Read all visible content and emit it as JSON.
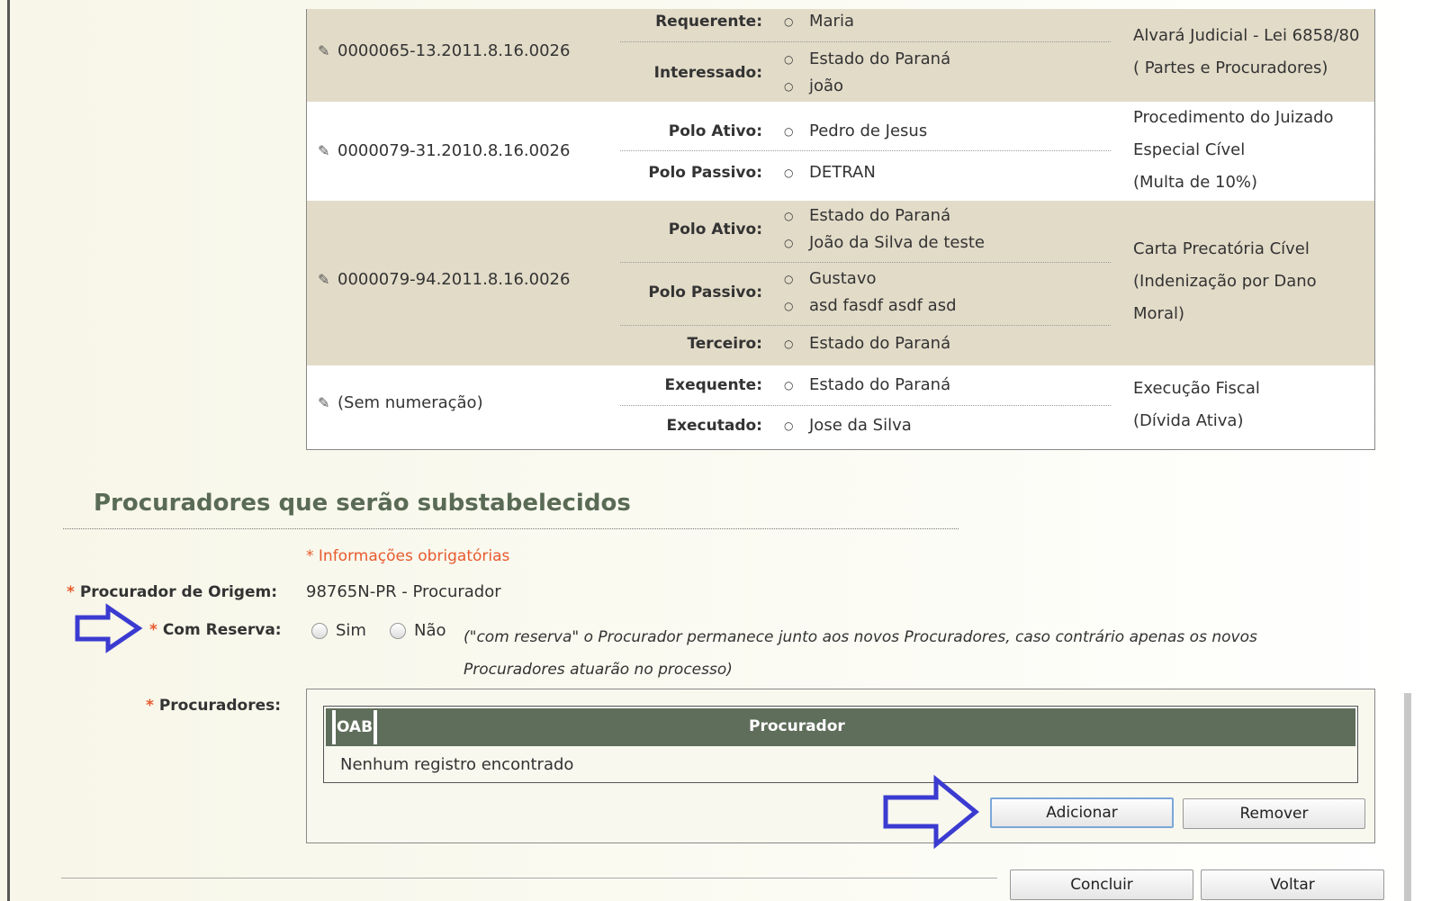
{
  "processes": [
    {
      "number": "0000065-13.2011.8.16.0026",
      "parties": [
        {
          "role": "Requerente:",
          "names": [
            "Maria"
          ]
        },
        {
          "role": "Interessado:",
          "names": [
            "Estado do Paraná",
            "joão"
          ]
        }
      ],
      "description": [
        "Alvará Judicial - Lei 6858/80",
        "( Partes e Procuradores)"
      ]
    },
    {
      "number": "0000079-31.2010.8.16.0026",
      "parties": [
        {
          "role": "Polo Ativo:",
          "names": [
            "Pedro de Jesus"
          ]
        },
        {
          "role": "Polo Passivo:",
          "names": [
            "DETRAN"
          ]
        }
      ],
      "description": [
        "Procedimento do Juizado",
        "Especial Cível",
        "(Multa de 10%)"
      ]
    },
    {
      "number": "0000079-94.2011.8.16.0026",
      "parties": [
        {
          "role": "Polo Ativo:",
          "names": [
            "Estado do Paraná",
            "João da Silva de teste"
          ]
        },
        {
          "role": "Polo Passivo:",
          "names": [
            "Gustavo",
            "asd fasdf asdf asd"
          ]
        },
        {
          "role": "Terceiro:",
          "names": [
            "Estado do Paraná"
          ]
        }
      ],
      "description": [
        "Carta Precatória Cível",
        "(Indenização por Dano",
        "Moral)"
      ]
    },
    {
      "number": "(Sem numeração)",
      "parties": [
        {
          "role": "Exequente:",
          "names": [
            "Estado do Paraná"
          ]
        },
        {
          "role": "Executado:",
          "names": [
            "Jose da Silva"
          ]
        }
      ],
      "description": [
        "Execução Fiscal",
        "(Dívida Ativa)"
      ]
    }
  ],
  "section": {
    "title": "Procuradores que serão substabelecidos",
    "required_note": "* Informações obrigatórias"
  },
  "form": {
    "origem_label": "Procurador de Origem:",
    "origem_value": "98765N-PR - Procurador",
    "reserva_label": "Com Reserva:",
    "reserva_options": [
      "Sim",
      "Não"
    ],
    "reserva_hint": "(\"com reserva\" o Procurador permanece junto aos novos Procuradores, caso contrário apenas os novos Procuradores atuarão no processo)",
    "procuradores_label": "Procuradores:",
    "required_star": "*"
  },
  "procuradores_table": {
    "col_oab": "OAB",
    "col_procurador": "Procurador",
    "empty_message": "Nenhum registro encontrado"
  },
  "buttons": {
    "adicionar": "Adicionar",
    "remover": "Remover",
    "concluir": "Concluir",
    "voltar": "Voltar"
  },
  "icons": {
    "edit": "pencil-icon",
    "annotation": "blue-arrow-icon"
  },
  "colors": {
    "header": "#5f6d5b",
    "shaded_row": "#e2dbc8",
    "required": "#e85a2e",
    "arrow": "#3b3bd1",
    "title": "#5a6b55"
  }
}
